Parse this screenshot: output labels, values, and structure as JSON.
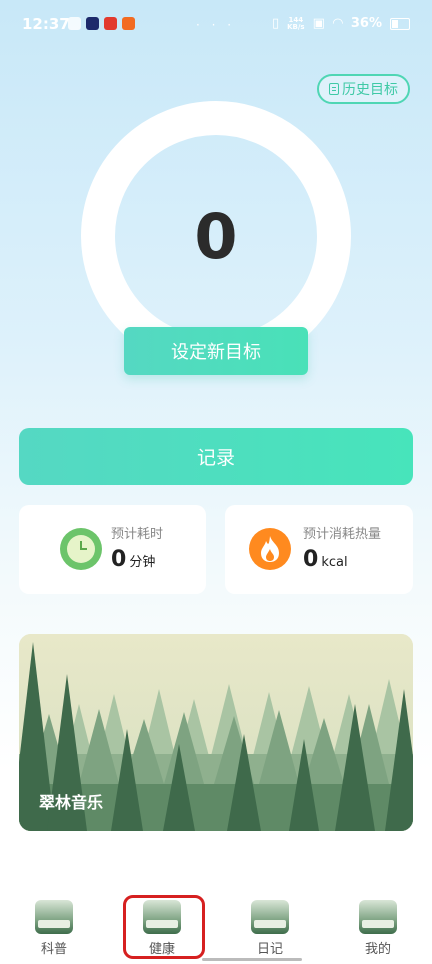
{
  "status_bar": {
    "time": "12:37",
    "dots": "· · ·",
    "net_speed_value": "144",
    "net_speed_unit": "KB/s",
    "battery": "36%"
  },
  "header": {
    "history_label": "历史目标"
  },
  "goal": {
    "value": "0",
    "set_goal_label": "设定新目标"
  },
  "record_label": "记录",
  "stats": {
    "time": {
      "label": "预计耗时",
      "value": "0",
      "unit": "分钟",
      "icon": "clock-icon"
    },
    "calories": {
      "label": "预计消耗热量",
      "value": "0",
      "unit": "kcal",
      "icon": "flame-icon"
    }
  },
  "banner": {
    "title": "翠林音乐"
  },
  "tabs": [
    {
      "label": "科普",
      "thumb_text": ""
    },
    {
      "label": "健康",
      "thumb_text": ""
    },
    {
      "label": "日记",
      "thumb_text": ""
    },
    {
      "label": "我的",
      "thumb_text": ""
    }
  ],
  "colors": {
    "accent": "#4fd8bd",
    "clock": "#6cc46a",
    "flame": "#ff8a1f",
    "highlight": "#d62020"
  }
}
